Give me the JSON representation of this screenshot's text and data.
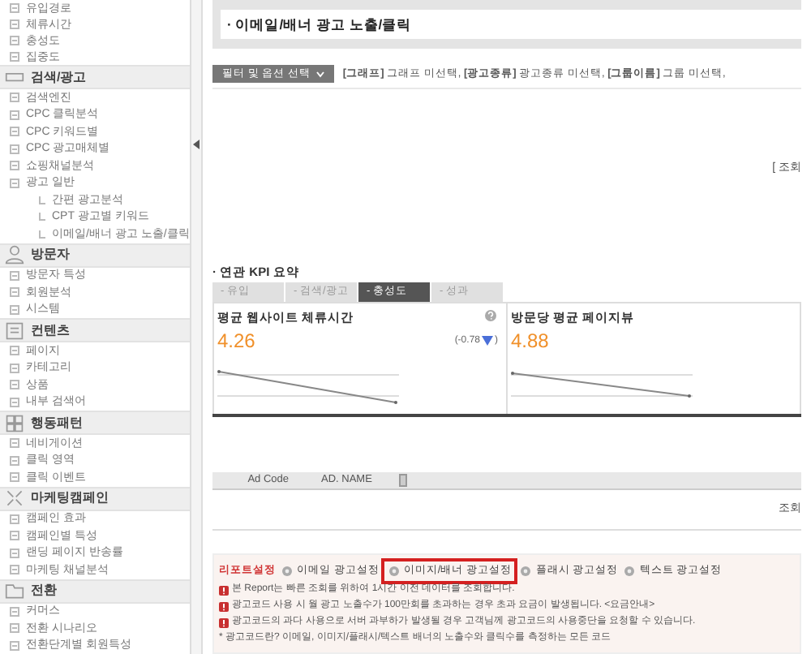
{
  "sidebar": {
    "items": [
      {
        "label": "유입경로"
      },
      {
        "label": "체류시간"
      },
      {
        "label": "충성도"
      },
      {
        "label": "집중도"
      }
    ],
    "sections": [
      {
        "title": "검색/광고",
        "items": [
          {
            "label": "검색엔진"
          },
          {
            "label": "CPC 클릭분석"
          },
          {
            "label": "CPC 키워드별"
          },
          {
            "label": "CPC 광고매체별"
          },
          {
            "label": "쇼핑채널분석"
          },
          {
            "label": "광고 일반",
            "children": [
              {
                "label": "간편 광고분석"
              },
              {
                "label": "CPT 광고별 키워드"
              },
              {
                "label": "이메일/배너 광고 노출/클릭"
              }
            ]
          }
        ]
      },
      {
        "title": "방문자",
        "items": [
          {
            "label": "방문자 특성"
          },
          {
            "label": "회원분석"
          },
          {
            "label": "시스템"
          }
        ]
      },
      {
        "title": "컨텐츠",
        "items": [
          {
            "label": "페이지"
          },
          {
            "label": "카테고리"
          },
          {
            "label": "상품"
          },
          {
            "label": "내부 검색어"
          }
        ]
      },
      {
        "title": "행동패턴",
        "items": [
          {
            "label": "네비게이션"
          },
          {
            "label": "클릭 영역"
          },
          {
            "label": "클릭 이벤트"
          }
        ]
      },
      {
        "title": "마케팅캠페인",
        "items": [
          {
            "label": "캠페인 효과"
          },
          {
            "label": "캠페인별 특성"
          },
          {
            "label": "랜딩 페이지 반송률"
          },
          {
            "label": "마케팅 채널분석"
          }
        ]
      },
      {
        "title": "전환",
        "items": [
          {
            "label": "커머스"
          },
          {
            "label": "전환 시나리오"
          },
          {
            "label": "전환단계별 회원특성"
          }
        ]
      }
    ]
  },
  "page_title": "· 이메일/배너 광고 노출/클릭",
  "filter": {
    "button": "필터 및 옵션 선택",
    "summary": "**[그래프]** 그래프 미선택, **[광고종류]** 광고종류 미선택, **[그룹이름]** 그룹 미선택,"
  },
  "period_label": "[ 조회",
  "kpi": {
    "title": "· 연관 KPI 요약",
    "tabs": [
      {
        "label": "- 유입",
        "selected": false
      },
      {
        "label": "- 검색/광고",
        "selected": false
      },
      {
        "label": "- 충성도",
        "selected": true
      },
      {
        "label": "- 성과",
        "selected": false
      }
    ],
    "cards": [
      {
        "title": "평균 웹사이트 체류시간",
        "value": "4.26",
        "change": "(-0.78",
        "change_close": ")",
        "help": true
      },
      {
        "title": "방문당 평균 페이지뷰",
        "value": "4.88",
        "help": false
      }
    ]
  },
  "table": {
    "columns": [
      "Ad Code",
      "AD. NAME"
    ],
    "empty_label": "조회"
  },
  "report_settings": {
    "title": "리포트설정",
    "links": [
      {
        "label": "이메일 광고설정",
        "selected": false
      },
      {
        "label": "이미지/배너 광고설정",
        "selected": true
      },
      {
        "label": "플래시 광고설정",
        "selected": false
      },
      {
        "label": "텍스트 광고설정",
        "selected": false
      }
    ],
    "notices": [
      "본 Report는 빠른 조회를 위하여 1시간 이전 데이터를 조회합니다.",
      "광고코드 사용 시 월 광고 노출수가 100만회를 초과하는 경우 초과 요금이 발생됩니다. <요금안내>",
      "광고코드의 과다 사용으로 서버 과부하가 발생될 경우 고객님께 광고코드의 사용중단을 요청할 수 있습니다."
    ],
    "footnote": "* 광고코드란? 이메일, 이미지/플래시/텍스트 배너의 노출수와 클릭수를 측정하는 모든 코드"
  }
}
